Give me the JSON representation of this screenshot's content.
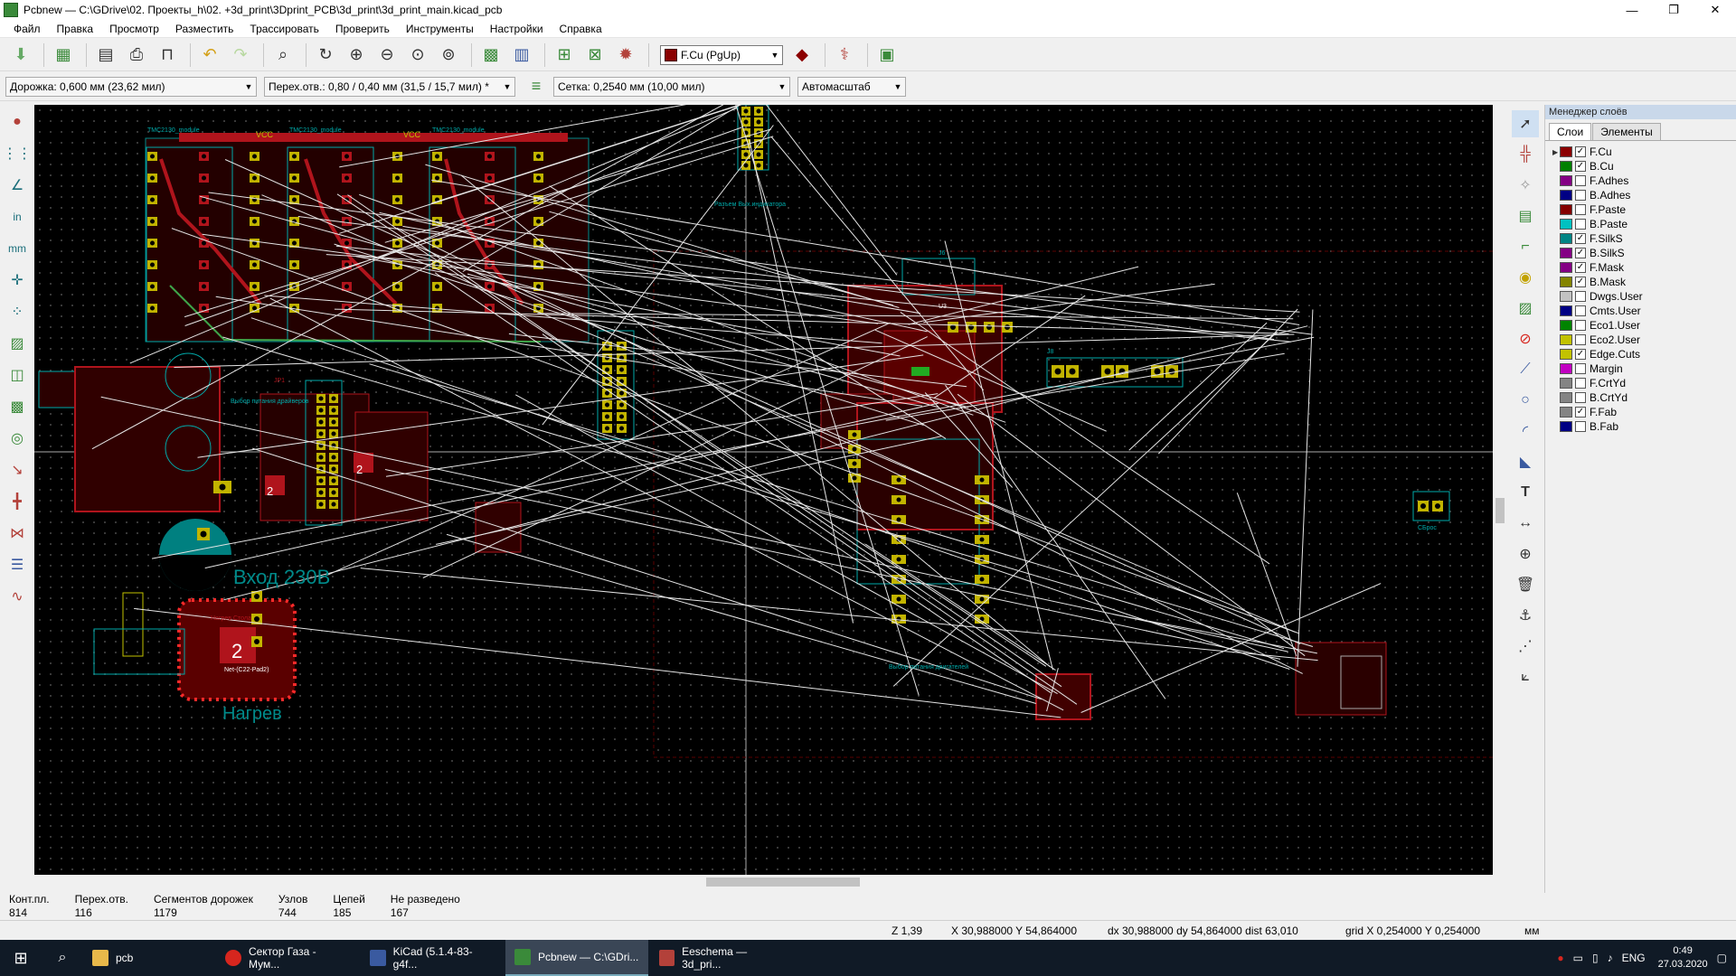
{
  "window": {
    "title": "Pcbnew — C:\\GDrive\\02. Проекты_h\\02. +3d_print\\3Dprint_PCB\\3d_print\\3d_print_main.kicad_pcb",
    "minimize": "—",
    "maximize": "❐",
    "close": "✕"
  },
  "menu": [
    "Файл",
    "Правка",
    "Просмотр",
    "Разместить",
    "Трассировать",
    "Проверить",
    "Инструменты",
    "Настройки",
    "Справка"
  ],
  "toolbar": {
    "layer_select": "F.Cu (PgUp)",
    "layer_color": "#8b0000"
  },
  "toolbar2": {
    "track": "Дорожка: 0,600 мм (23,62 мил)",
    "via": "Перех.отв.: 0,80 / 0,40 мм (31,5 / 15,7 мил) *",
    "grid": "Сетка: 0,2540 мм (10,00 мил)",
    "zoom": "Автомасштаб"
  },
  "left_tools": [
    "drc-icon",
    "grid-icon",
    "polar-icon",
    "inch-icon",
    "mm-icon",
    "cursor-icon",
    "ratsnest-icon",
    "zone-icon",
    "zone-outline-icon",
    "zone-fill-icon",
    "via-icon",
    "track-icon",
    "pad-icon",
    "microwave-icon",
    "layers-icon",
    "hv-icon"
  ],
  "right_tools": [
    "select-icon",
    "add-footprint-icon",
    "highlight-net-icon",
    "route-icon",
    "diff-route-icon",
    "via-add-icon",
    "zone-add-icon",
    "keepout-icon",
    "line-icon",
    "circle-icon",
    "arc-icon",
    "polygon-icon",
    "text-icon",
    "dimension-icon",
    "target-icon",
    "delete-icon",
    "anchor-icon",
    "grid-origin-icon",
    "measure-icon"
  ],
  "layer_manager": {
    "title": "Менеджер слоёв",
    "tabs": [
      "Слои",
      "Элементы"
    ],
    "layers": [
      {
        "name": "F.Cu",
        "color": "#8b0000",
        "checked": true,
        "active": true
      },
      {
        "name": "B.Cu",
        "color": "#008000",
        "checked": true
      },
      {
        "name": "F.Adhes",
        "color": "#840084",
        "checked": false
      },
      {
        "name": "B.Adhes",
        "color": "#000084",
        "checked": false
      },
      {
        "name": "F.Paste",
        "color": "#840000",
        "checked": false
      },
      {
        "name": "B.Paste",
        "color": "#00c2c2",
        "checked": false
      },
      {
        "name": "F.SilkS",
        "color": "#008484",
        "checked": true
      },
      {
        "name": "B.SilkS",
        "color": "#840084",
        "checked": true
      },
      {
        "name": "F.Mask",
        "color": "#840084",
        "checked": true
      },
      {
        "name": "B.Mask",
        "color": "#848400",
        "checked": true
      },
      {
        "name": "Dwgs.User",
        "color": "#c2c2c2",
        "checked": false
      },
      {
        "name": "Cmts.User",
        "color": "#000084",
        "checked": false
      },
      {
        "name": "Eco1.User",
        "color": "#008400",
        "checked": false
      },
      {
        "name": "Eco2.User",
        "color": "#c2c200",
        "checked": false
      },
      {
        "name": "Edge.Cuts",
        "color": "#c2c200",
        "checked": true
      },
      {
        "name": "Margin",
        "color": "#c200c2",
        "checked": false
      },
      {
        "name": "F.CrtYd",
        "color": "#848484",
        "checked": false
      },
      {
        "name": "B.CrtYd",
        "color": "#848484",
        "checked": false
      },
      {
        "name": "F.Fab",
        "color": "#848484",
        "checked": true
      },
      {
        "name": "B.Fab",
        "color": "#000084",
        "checked": false
      }
    ]
  },
  "board_text": {
    "vcc1": "VCC",
    "vcc2": "VCC",
    "mod1": "TMC2130_module",
    "mod2": "TMC2130_module",
    "mod3": "TMC2130_module",
    "input": "Вход 230В",
    "heat": "Нагрев",
    "num2a": "2",
    "num2b": "2",
    "num2c": "2",
    "heat_note": "Нагрев Стола",
    "net_label": "Net-(C22-Pad2)",
    "power_sel": "Выбор питания драйверов",
    "power_sel2": "Выбор питания двигателей",
    "reset": "СБрос",
    "jp1": "JP1",
    "j6": "J6",
    "j8": "J8",
    "u3": "U3",
    "ref_m8": "Разъем Вых.индикатора"
  },
  "message_panel": [
    {
      "label": "Конт.пл.",
      "value": "814"
    },
    {
      "label": "Перех.отв.",
      "value": "116"
    },
    {
      "label": "Сегментов дорожек",
      "value": "1179"
    },
    {
      "label": "Узлов",
      "value": "744"
    },
    {
      "label": "Цепей",
      "value": "185"
    },
    {
      "label": "Не разведено",
      "value": "167"
    }
  ],
  "statusbar": {
    "zoom": "Z 1,39",
    "xy": "X 30,988000  Y 54,864000",
    "dxy": "dx 30,988000  dy 54,864000  dist 63,010",
    "grid": "grid X 0,254000  Y 0,254000",
    "units": "мм"
  },
  "taskbar": {
    "items": [
      {
        "label": "pcb",
        "color": "#e8b84a"
      },
      {
        "label": "Сектор Газа - Мум...",
        "color": "#d7261e"
      },
      {
        "label": "KiCad (5.1.4-83-g4f...",
        "color": "#3a5aa0"
      },
      {
        "label": "Pcbnew — C:\\GDri...",
        "color": "#3a8a3a",
        "active": true
      },
      {
        "label": "Eeschema — 3d_pri...",
        "color": "#b3413a"
      }
    ],
    "lang": "ENG",
    "time": "0:49",
    "date": "27.03.2020"
  }
}
